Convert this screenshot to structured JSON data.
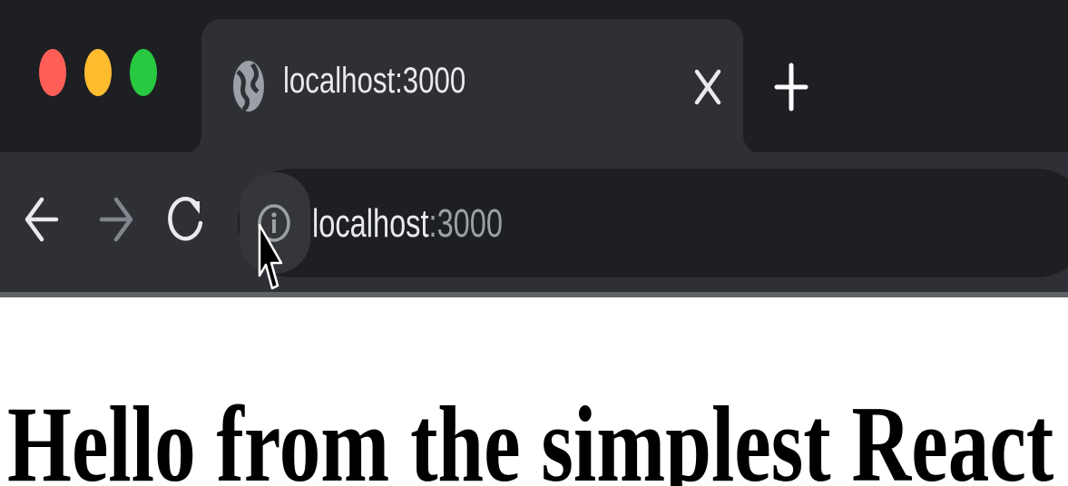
{
  "window": {
    "controls": [
      "close",
      "minimize",
      "maximize"
    ]
  },
  "tab": {
    "title": "localhost:3000",
    "favicon": "globe-icon",
    "close_label": "X",
    "new_tab_label": "+"
  },
  "toolbar": {
    "back_icon": "arrow-left-icon",
    "forward_icon": "arrow-right-icon",
    "reload_icon": "reload-icon",
    "site_info_icon": "info-icon",
    "url_host": "localhost",
    "url_port": ":3000"
  },
  "page": {
    "heading": "Hello from the simplest React SSR"
  },
  "colors": {
    "tabstrip_bg": "#1e1f22",
    "active_tab_bg": "#2f3035",
    "omnibox_bg": "#1e1f22",
    "text_primary": "#e8eaed",
    "text_secondary": "#9aa0a6",
    "traffic_red": "#fd5f57",
    "traffic_yellow": "#febc2e",
    "traffic_green": "#28c840"
  }
}
